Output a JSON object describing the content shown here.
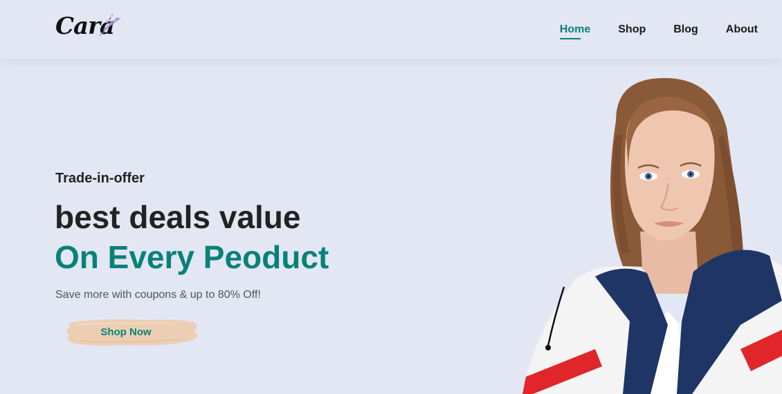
{
  "header": {
    "logo_text": "Cara",
    "nav": [
      {
        "label": "Home",
        "active": true
      },
      {
        "label": "Shop",
        "active": false
      },
      {
        "label": "Blog",
        "active": false
      },
      {
        "label": "About",
        "active": false
      }
    ]
  },
  "hero": {
    "subtitle": "Trade-in-offer",
    "title_line1": "best deals value",
    "title_line2": "On Every Peoduct",
    "description": "Save more with coupons & up to 80% Off!",
    "button_label": "Shop Now"
  },
  "colors": {
    "background": "#e3e6f3",
    "accent": "#088178",
    "button_brush": "#eccfb3",
    "text_dark": "#222222"
  },
  "icons": {
    "logo_flower": "lavender-sprig-icon"
  }
}
